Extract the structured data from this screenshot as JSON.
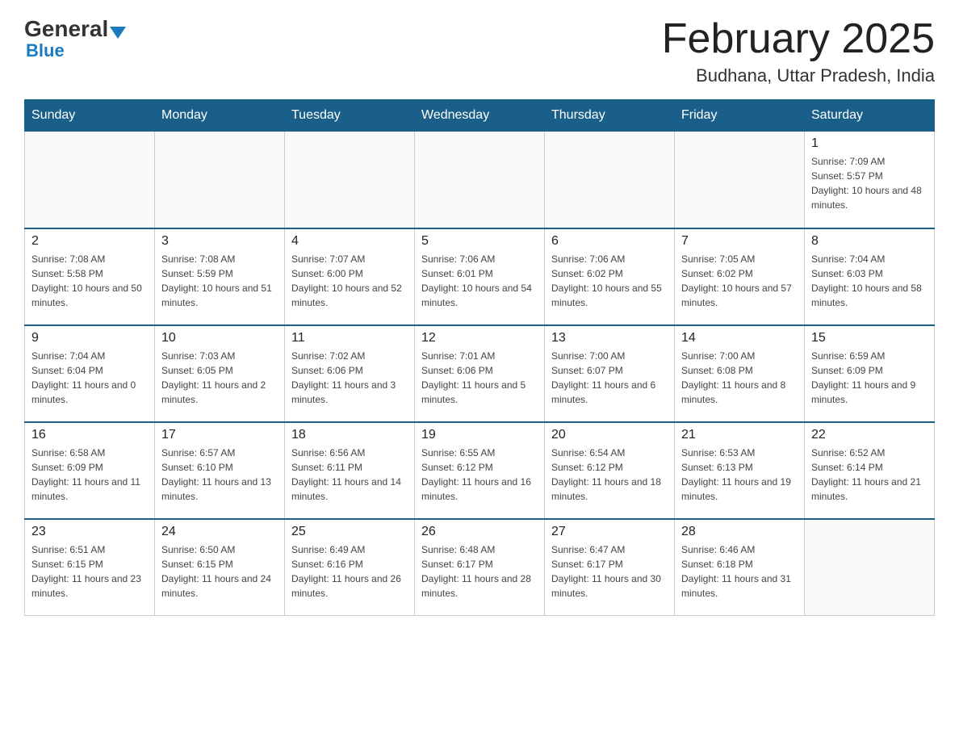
{
  "header": {
    "logo_general": "General",
    "logo_blue": "Blue",
    "month_title": "February 2025",
    "location": "Budhana, Uttar Pradesh, India"
  },
  "days_of_week": [
    "Sunday",
    "Monday",
    "Tuesday",
    "Wednesday",
    "Thursday",
    "Friday",
    "Saturday"
  ],
  "weeks": [
    [
      {
        "day": "",
        "info": ""
      },
      {
        "day": "",
        "info": ""
      },
      {
        "day": "",
        "info": ""
      },
      {
        "day": "",
        "info": ""
      },
      {
        "day": "",
        "info": ""
      },
      {
        "day": "",
        "info": ""
      },
      {
        "day": "1",
        "info": "Sunrise: 7:09 AM\nSunset: 5:57 PM\nDaylight: 10 hours and 48 minutes."
      }
    ],
    [
      {
        "day": "2",
        "info": "Sunrise: 7:08 AM\nSunset: 5:58 PM\nDaylight: 10 hours and 50 minutes."
      },
      {
        "day": "3",
        "info": "Sunrise: 7:08 AM\nSunset: 5:59 PM\nDaylight: 10 hours and 51 minutes."
      },
      {
        "day": "4",
        "info": "Sunrise: 7:07 AM\nSunset: 6:00 PM\nDaylight: 10 hours and 52 minutes."
      },
      {
        "day": "5",
        "info": "Sunrise: 7:06 AM\nSunset: 6:01 PM\nDaylight: 10 hours and 54 minutes."
      },
      {
        "day": "6",
        "info": "Sunrise: 7:06 AM\nSunset: 6:02 PM\nDaylight: 10 hours and 55 minutes."
      },
      {
        "day": "7",
        "info": "Sunrise: 7:05 AM\nSunset: 6:02 PM\nDaylight: 10 hours and 57 minutes."
      },
      {
        "day": "8",
        "info": "Sunrise: 7:04 AM\nSunset: 6:03 PM\nDaylight: 10 hours and 58 minutes."
      }
    ],
    [
      {
        "day": "9",
        "info": "Sunrise: 7:04 AM\nSunset: 6:04 PM\nDaylight: 11 hours and 0 minutes."
      },
      {
        "day": "10",
        "info": "Sunrise: 7:03 AM\nSunset: 6:05 PM\nDaylight: 11 hours and 2 minutes."
      },
      {
        "day": "11",
        "info": "Sunrise: 7:02 AM\nSunset: 6:06 PM\nDaylight: 11 hours and 3 minutes."
      },
      {
        "day": "12",
        "info": "Sunrise: 7:01 AM\nSunset: 6:06 PM\nDaylight: 11 hours and 5 minutes."
      },
      {
        "day": "13",
        "info": "Sunrise: 7:00 AM\nSunset: 6:07 PM\nDaylight: 11 hours and 6 minutes."
      },
      {
        "day": "14",
        "info": "Sunrise: 7:00 AM\nSunset: 6:08 PM\nDaylight: 11 hours and 8 minutes."
      },
      {
        "day": "15",
        "info": "Sunrise: 6:59 AM\nSunset: 6:09 PM\nDaylight: 11 hours and 9 minutes."
      }
    ],
    [
      {
        "day": "16",
        "info": "Sunrise: 6:58 AM\nSunset: 6:09 PM\nDaylight: 11 hours and 11 minutes."
      },
      {
        "day": "17",
        "info": "Sunrise: 6:57 AM\nSunset: 6:10 PM\nDaylight: 11 hours and 13 minutes."
      },
      {
        "day": "18",
        "info": "Sunrise: 6:56 AM\nSunset: 6:11 PM\nDaylight: 11 hours and 14 minutes."
      },
      {
        "day": "19",
        "info": "Sunrise: 6:55 AM\nSunset: 6:12 PM\nDaylight: 11 hours and 16 minutes."
      },
      {
        "day": "20",
        "info": "Sunrise: 6:54 AM\nSunset: 6:12 PM\nDaylight: 11 hours and 18 minutes."
      },
      {
        "day": "21",
        "info": "Sunrise: 6:53 AM\nSunset: 6:13 PM\nDaylight: 11 hours and 19 minutes."
      },
      {
        "day": "22",
        "info": "Sunrise: 6:52 AM\nSunset: 6:14 PM\nDaylight: 11 hours and 21 minutes."
      }
    ],
    [
      {
        "day": "23",
        "info": "Sunrise: 6:51 AM\nSunset: 6:15 PM\nDaylight: 11 hours and 23 minutes."
      },
      {
        "day": "24",
        "info": "Sunrise: 6:50 AM\nSunset: 6:15 PM\nDaylight: 11 hours and 24 minutes."
      },
      {
        "day": "25",
        "info": "Sunrise: 6:49 AM\nSunset: 6:16 PM\nDaylight: 11 hours and 26 minutes."
      },
      {
        "day": "26",
        "info": "Sunrise: 6:48 AM\nSunset: 6:17 PM\nDaylight: 11 hours and 28 minutes."
      },
      {
        "day": "27",
        "info": "Sunrise: 6:47 AM\nSunset: 6:17 PM\nDaylight: 11 hours and 30 minutes."
      },
      {
        "day": "28",
        "info": "Sunrise: 6:46 AM\nSunset: 6:18 PM\nDaylight: 11 hours and 31 minutes."
      },
      {
        "day": "",
        "info": ""
      }
    ]
  ]
}
